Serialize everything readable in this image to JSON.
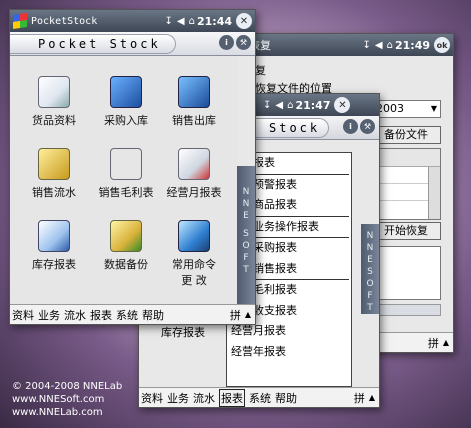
{
  "restore_window": {
    "title_partial": "据恢复",
    "time": "21:49",
    "ok_label": "ok",
    "section_label": "复",
    "path_label": "恢复文件的位置",
    "select_value": "2003",
    "backup_file_button": "备份文件",
    "start_restore_button": "开始恢复",
    "input_label": "拼"
  },
  "report_window": {
    "time": "21:47",
    "tab_title": "Stock",
    "menu_items": [
      "库存报表",
      "库存预警报表",
      "销售商品报表",
      "商品业务操作报表",
      "商品采购报表",
      "商品销售报表",
      "销售毛利报表",
      "营业收支报表",
      "经营月报表",
      "经营年报表"
    ],
    "under_menu_item": "库存报表",
    "menubar": [
      "资料",
      "业务",
      "流水",
      "报表",
      "系统",
      "帮助"
    ],
    "input_label": "拼"
  },
  "main_window": {
    "app_title": "PocketStock",
    "time": "21:44",
    "close_label": "✕",
    "header_title": "Pocket Stock",
    "icons": [
      {
        "label": "货品资料",
        "icon": "document-icon"
      },
      {
        "label": "采购入库",
        "icon": "purchase-icon"
      },
      {
        "label": "销售出库",
        "icon": "sale-icon"
      },
      {
        "label": "销售流水",
        "icon": "flow-icon"
      },
      {
        "label": "销售毛利表",
        "icon": "profit-icon"
      },
      {
        "label": "经营月报表",
        "icon": "monthly-icon"
      },
      {
        "label": "库存报表",
        "icon": "inventory-icon"
      },
      {
        "label": "数据备份",
        "icon": "backup-icon"
      },
      {
        "label": "常用命令",
        "label2": "更 改",
        "icon": "command-icon"
      }
    ],
    "menubar": [
      "资料",
      "业务",
      "流水",
      "报表",
      "系统",
      "帮助"
    ],
    "input_label": "拼"
  },
  "sidebar_text": [
    "N",
    "N",
    "E",
    "S",
    "O",
    "F",
    "T"
  ],
  "footer": [
    "© 2004-2008 NNELab",
    "www.NNESoft.com",
    "www.NNELab.com"
  ]
}
